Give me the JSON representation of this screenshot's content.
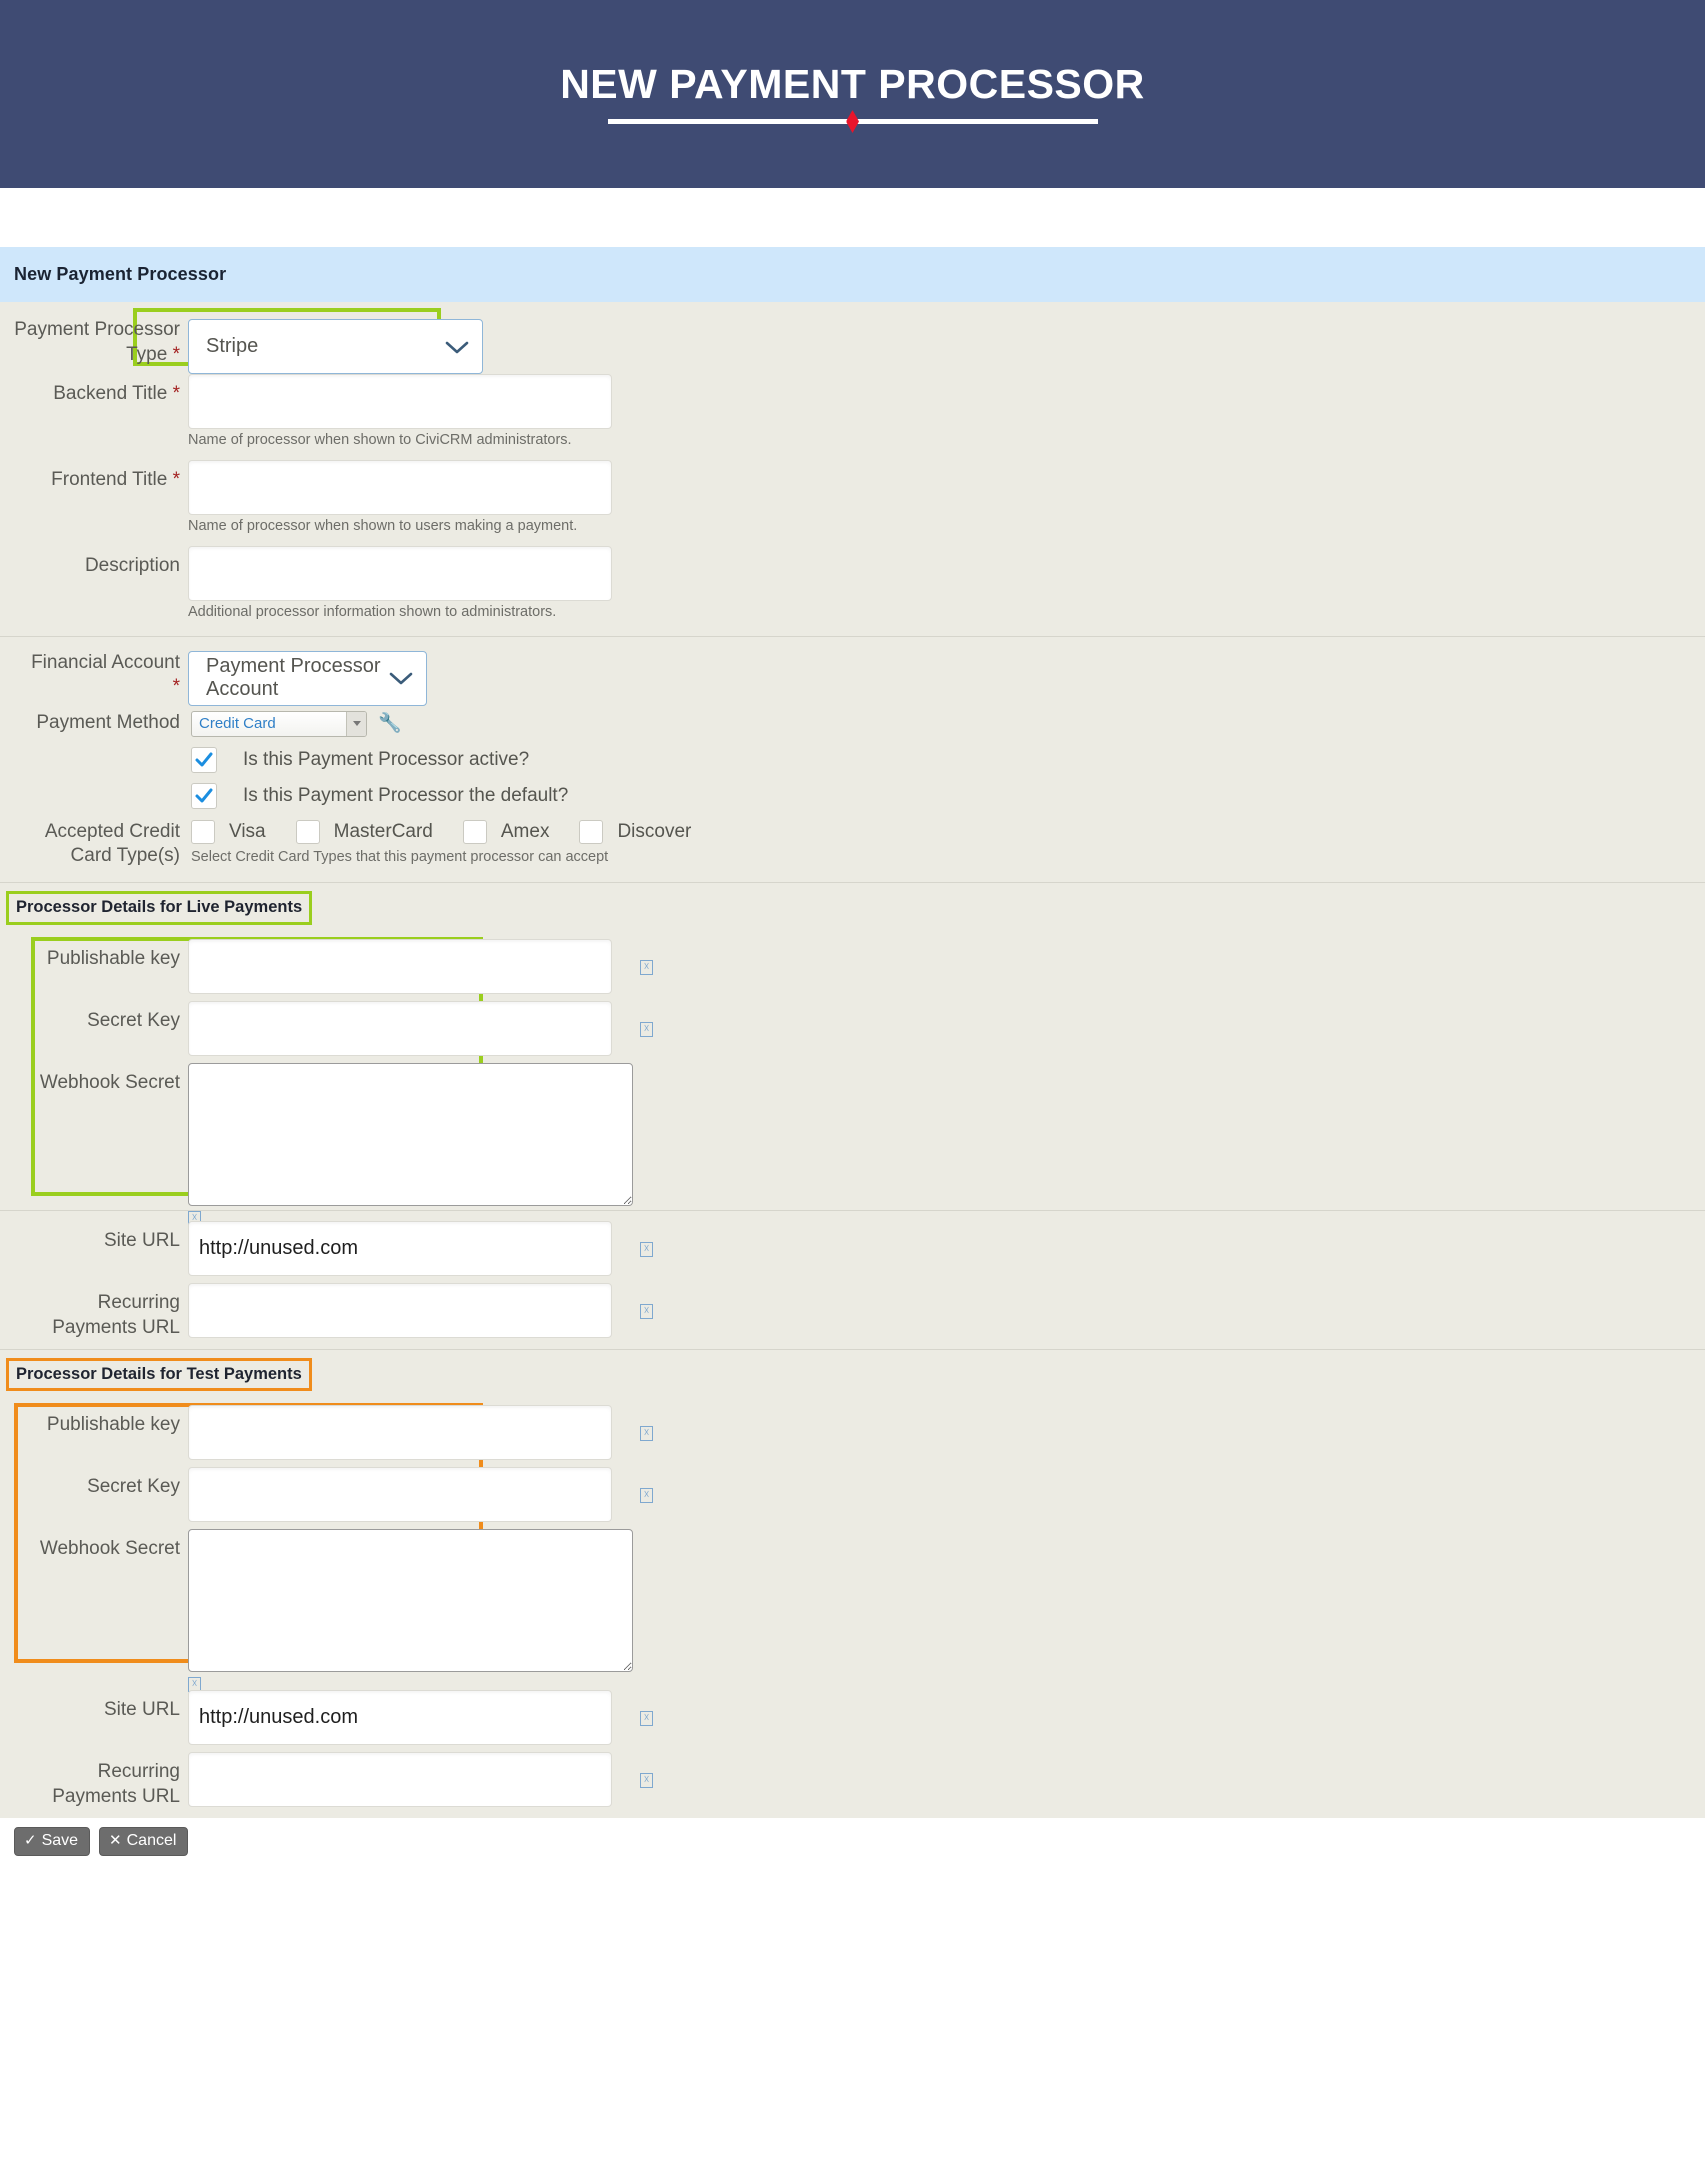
{
  "hero": {
    "title": "NEW PAYMENT PROCESSOR",
    "accent_color": "#e8152b",
    "background_color": "#3f4b73"
  },
  "panel": {
    "header": "New Payment Processor"
  },
  "colors": {
    "highlight_green": "#9ace1e",
    "highlight_orange": "#f08c1b",
    "panel_header_bg": "#cfe7fb",
    "form_bg": "#ecebe3"
  },
  "form": {
    "processor_type": {
      "label": "Payment Processor Type",
      "required": "*",
      "value": "Stripe"
    },
    "backend_title": {
      "label": "Backend Title",
      "required": "*",
      "value": "",
      "help": "Name of processor when shown to CiviCRM administrators."
    },
    "frontend_title": {
      "label": "Frontend Title",
      "required": "*",
      "value": "",
      "help": "Name of processor when shown to users making a payment."
    },
    "description": {
      "label": "Description",
      "value": "",
      "help": "Additional processor information shown to administrators."
    },
    "financial_account": {
      "label": "Financial Account",
      "required": "*",
      "value": "Payment Processor Account"
    },
    "payment_method": {
      "label": "Payment Method",
      "value": "Credit Card"
    },
    "active_checkbox": {
      "label": "Is this Payment Processor active?",
      "checked": true
    },
    "default_checkbox": {
      "label": "Is this Payment Processor the default?",
      "checked": true
    },
    "credit_cards": {
      "label_line1": "Accepted Credit",
      "label_line2": "Card Type(s)",
      "help": "Select Credit Card Types that this payment processor can accept",
      "options": [
        {
          "label": "Visa",
          "checked": false
        },
        {
          "label": "MasterCard",
          "checked": false
        },
        {
          "label": "Amex",
          "checked": false
        },
        {
          "label": "Discover",
          "checked": false
        }
      ]
    }
  },
  "live_section": {
    "title": "Processor Details for Live Payments",
    "publishable_key": {
      "label": "Publishable key",
      "value": ""
    },
    "secret_key": {
      "label": "Secret Key",
      "value": ""
    },
    "webhook_secret": {
      "label": "Webhook Secret",
      "value": ""
    },
    "site_url": {
      "label": "Site URL",
      "value": "http://unused.com"
    },
    "recurring_url": {
      "label_line1": "Recurring",
      "label_line2": "Payments URL",
      "value": ""
    }
  },
  "test_section": {
    "title": "Processor Details for Test Payments",
    "publishable_key": {
      "label": "Publishable key",
      "value": ""
    },
    "secret_key": {
      "label": "Secret Key",
      "value": ""
    },
    "webhook_secret": {
      "label": "Webhook Secret",
      "value": ""
    },
    "site_url": {
      "label": "Site URL",
      "value": "http://unused.com"
    },
    "recurring_url": {
      "label_line1": "Recurring",
      "label_line2": "Payments URL",
      "value": ""
    }
  },
  "actions": {
    "save": "Save",
    "cancel": "Cancel",
    "save_glyph": "✓",
    "cancel_glyph": "✕"
  }
}
